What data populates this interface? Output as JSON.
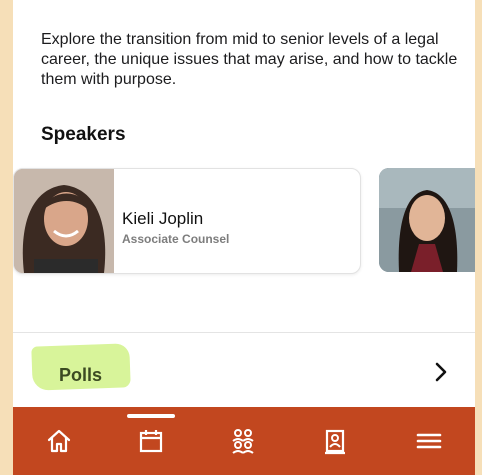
{
  "session": {
    "description": "Explore the transition from mid to senior levels of a legal career, the unique issues that may arise, and how to tackle them with purpose."
  },
  "speakers_section": {
    "title": "Speakers",
    "speakers": [
      {
        "name": "Kieli Joplin",
        "role": "Associate Counsel"
      }
    ]
  },
  "polls": {
    "label": "Polls"
  },
  "tabbar": {
    "background": "#c2471f",
    "tabs": [
      {
        "icon": "home-icon",
        "active": false
      },
      {
        "icon": "calendar-icon",
        "active": true
      },
      {
        "icon": "people-icon",
        "active": false
      },
      {
        "icon": "contact-book-icon",
        "active": false
      },
      {
        "icon": "menu-icon",
        "active": false
      }
    ]
  },
  "colors": {
    "highlight": "#d8f49a",
    "page_border": "#f6dfb8"
  }
}
